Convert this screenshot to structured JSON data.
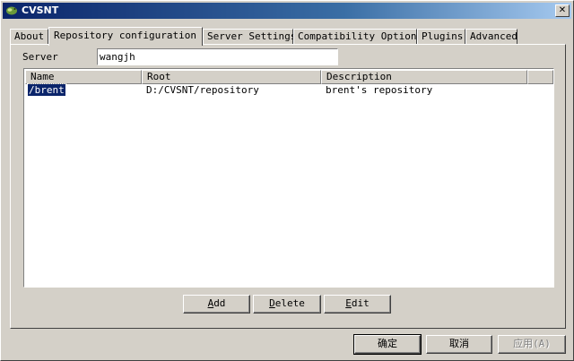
{
  "window": {
    "title": "CVSNT",
    "icon": "cvsnt-app-icon",
    "close_label": "✕"
  },
  "tabs": [
    {
      "label": "About",
      "active": false
    },
    {
      "label": "Repository configuration",
      "active": true
    },
    {
      "label": "Server Settings",
      "active": false
    },
    {
      "label": "Compatibility Options",
      "active": false
    },
    {
      "label": "Plugins",
      "active": false
    },
    {
      "label": "Advanced",
      "active": false
    }
  ],
  "server": {
    "label": "Server",
    "value": "wangjh"
  },
  "list": {
    "columns": [
      "Name",
      "Root",
      "Description"
    ],
    "rows": [
      {
        "name": "/brent",
        "root": "D:/CVSNT/repository",
        "description": "brent's repository",
        "selected": true
      }
    ]
  },
  "actions": {
    "add": {
      "prefix": "",
      "accel": "A",
      "rest": "dd"
    },
    "delete": {
      "prefix": "",
      "accel": "D",
      "rest": "elete"
    },
    "edit": {
      "prefix": "",
      "accel": "E",
      "rest": "dit"
    }
  },
  "footer": {
    "ok": "确定",
    "cancel": "取消",
    "apply_text": "应用",
    "apply_accel": "(A)"
  },
  "colors": {
    "face": "#d4d0c8",
    "title_active": "#0a246a",
    "selection": "#0a246a"
  }
}
